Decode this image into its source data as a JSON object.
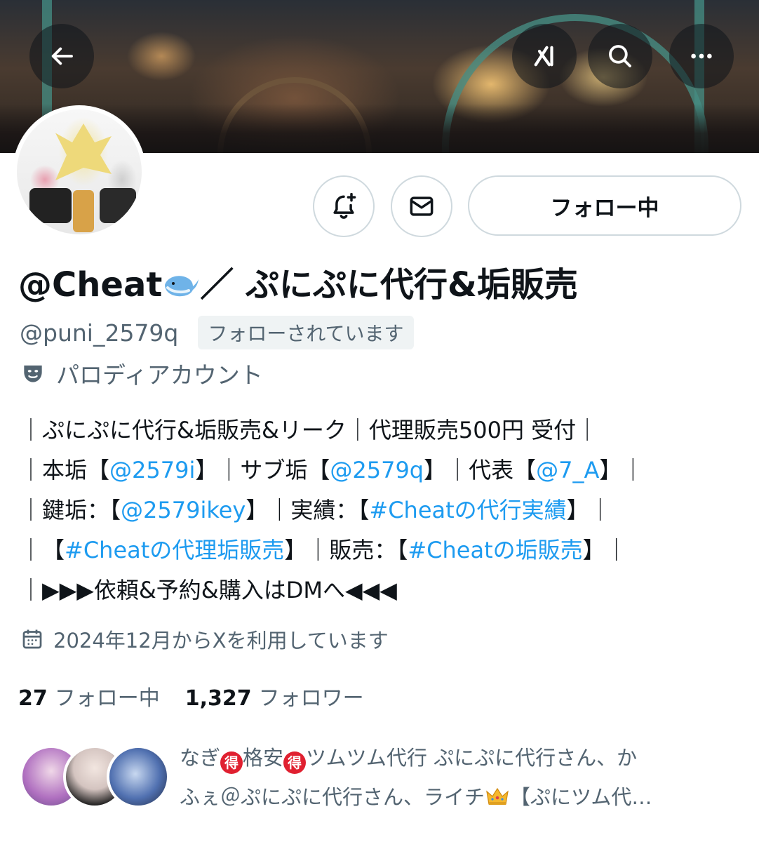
{
  "header": {
    "back_icon": "arrow-left-icon",
    "grok_icon": "grok-icon",
    "search_icon": "search-icon",
    "more_icon": "more-horizontal-icon"
  },
  "profile": {
    "display_name_part1": "@Cheat",
    "display_name_emoji": "whale-emoji",
    "display_name_part2": "／ ぷにぷに代行&垢販売",
    "handle": "@puni_2579q",
    "follows_you": "フォローされています",
    "parody_label": "パロディアカウント",
    "bio": {
      "line1": "｜ぷにぷに代行&垢販売&リーク｜代理販売500円 受付｜",
      "line2_a": "｜本垢【",
      "line2_link1": "@2579i",
      "line2_b": "】｜サブ垢【",
      "line2_link2": "@2579q",
      "line2_c": "】｜代表【",
      "line2_link3": "@7_A",
      "line2_d": "】｜",
      "line3_a": "｜鍵垢：【",
      "line3_link1": "@2579ikey",
      "line3_b": "】｜実績：【",
      "line3_link2": "#Cheatの代行実績",
      "line3_c": "】｜",
      "line4_a": "｜【",
      "line4_link1": "#Cheatの代理垢販売",
      "line4_b": "】｜販売：【",
      "line4_link2": "#Cheatの垢販売",
      "line4_c": "】｜",
      "line5": "｜▶▶▶依頼&予約&購入はDMへ◀◀◀"
    },
    "joined": "2024年12月からXを利用しています",
    "following_count": "27",
    "following_label": "フォロー中",
    "followers_count": "1,327",
    "followers_label": "フォロワー"
  },
  "actions": {
    "notify_icon": "bell-plus-icon",
    "message_icon": "mail-icon",
    "follow_button_label": "フォロー中"
  },
  "followed_by": {
    "line1_a": "なぎ",
    "line1_tok1": "得",
    "line1_b": "格安",
    "line1_tok2": "得",
    "line1_c": "ツムツム代行 ぷにぷに代行さん、か",
    "line2_a": "ふぇ＠ぷにぷに代行さん、ライチ",
    "line2_b": "【ぷにツム代…"
  },
  "colors": {
    "link": "#1d9bf0",
    "secondary_text": "#536471",
    "border": "#cfd9de"
  }
}
